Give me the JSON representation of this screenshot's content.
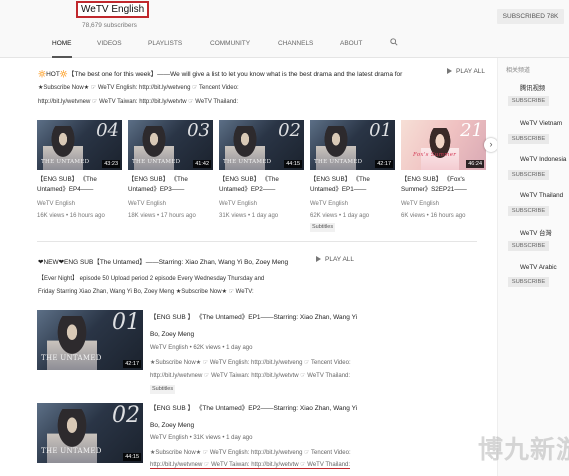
{
  "channel": {
    "title": "WeTV English",
    "subscriber_count": "78,679 subscribers",
    "subscribe_label": "SUBSCRIBED  78K"
  },
  "tabs": [
    {
      "label": "HOME",
      "active": true
    },
    {
      "label": "VIDEOS",
      "active": false
    },
    {
      "label": "PLAYLISTS",
      "active": false
    },
    {
      "label": "COMMUNITY",
      "active": false
    },
    {
      "label": "CHANNELS",
      "active": false
    },
    {
      "label": "ABOUT",
      "active": false
    }
  ],
  "section1": {
    "title": "🔆HOT🔆【The best one for this week】——We will give a list to let you know what is the best drama and the latest drama for",
    "desc": "★Subscribe Now★ ☞ WeTV English: http://bit.ly/wetveng ☞ Tencent Video:",
    "desc2": "http://bit.ly/wetvnew ☞ WeTV Taiwan: http://bit.ly/wetvtw ☞ WeTV Thailand:",
    "play_all": "PLAY ALL",
    "videos": [
      {
        "num": "04",
        "logo": "THE UNTAMED",
        "duration": "43:23",
        "title1": "【ENG SUB】 《The",
        "title2": "Untamed》EP4——",
        "channel": "WeTV English",
        "views": "16K views • 16 hours ago",
        "badge": ""
      },
      {
        "num": "03",
        "logo": "THE UNTAMED",
        "duration": "41:42",
        "title1": "【ENG SUB】 《The",
        "title2": "Untamed》EP3——",
        "channel": "WeTV English",
        "views": "18K views • 17 hours ago",
        "badge": ""
      },
      {
        "num": "02",
        "logo": "THE UNTAMED",
        "duration": "44:15",
        "title1": "【ENG SUB】 《The",
        "title2": "Untamed》EP2——",
        "channel": "WeTV English",
        "views": "31K views • 1 day ago",
        "badge": ""
      },
      {
        "num": "01",
        "logo": "THE UNTAMED",
        "duration": "42:17",
        "title1": "【ENG SUB】 《The",
        "title2": "Untamed》EP1——",
        "channel": "WeTV English",
        "views": "62K views • 1 day ago",
        "badge": "Subtitles"
      },
      {
        "num": "21",
        "logo": "Fox's Summer",
        "duration": "46:24",
        "title1": "【ENG SUB】 《Fox's",
        "title2": "Summer》S2EP21——",
        "channel": "WeTV English",
        "views": "6K views • 16 hours ago",
        "badge": ""
      }
    ]
  },
  "section2": {
    "title": "❤NEW❤ENG SUB【The Untamed】——Starring: Xiao Zhan, Wang Yi Bo, Zoey Meng",
    "play_all": "PLAY ALL",
    "desc": "【Ever Night】 episode 50 Upload period 2 episode Every Wednesday Thursday and",
    "desc2": "Friday Starring Xiao Zhan, Wang Yi Bo, Zoey Meng ★Subscribe Now★ ☞ WeTV:",
    "items": [
      {
        "num": "01",
        "logo": "THE UNTAMED",
        "duration": "42:17",
        "title1": "【ENG SUB 】 《The Untamed》EP1——Starring: Xiao Zhan, Wang Yi",
        "title2": "Bo, Zoey Meng",
        "meta": "WeTV English • 62K views • 1 day ago",
        "desc1": "★Subscribe Now★ ☞ WeTV English: http://bit.ly/wetveng ☞ Tencent Video:",
        "desc2": "http://bit.ly/wetvnew ☞ WeTV Taiwan: http://bit.ly/wetvtw ☞ WeTV Thailand:",
        "badge": "Subtitles"
      },
      {
        "num": "02",
        "logo": "THE UNTAMED",
        "duration": "44:15",
        "title1": "【ENG SUB 】 《The Untamed》EP2——Starring: Xiao Zhan, Wang Yi",
        "title2": "Bo, Zoey Meng",
        "meta": "WeTV English • 31K views • 1 day ago",
        "desc1": "★Subscribe Now★ ☞ WeTV English: http://bit.ly/wetveng ☞ Tencent Video:",
        "desc2": "http://bit.ly/wetvnew ☞ WeTV Taiwan: http://bit.ly/wetvtw ☞ WeTV Thailand:",
        "badge": ""
      }
    ]
  },
  "sidebar": {
    "heading": "相关频道",
    "channels": [
      {
        "name": "腾讯视频",
        "subscribe": "SUBSCRIBE"
      },
      {
        "name": "WeTV Vietnam",
        "subscribe": "SUBSCRIBE"
      },
      {
        "name": "WeTV Indonesia",
        "subscribe": "SUBSCRIBE"
      },
      {
        "name": "WeTV Thailand",
        "subscribe": "SUBSCRIBE"
      },
      {
        "name": "WeTV 台灣",
        "subscribe": "SUBSCRIBE"
      },
      {
        "name": "WeTV Arabic",
        "subscribe": "SUBSCRIBE"
      }
    ]
  },
  "watermark": "博九新游"
}
